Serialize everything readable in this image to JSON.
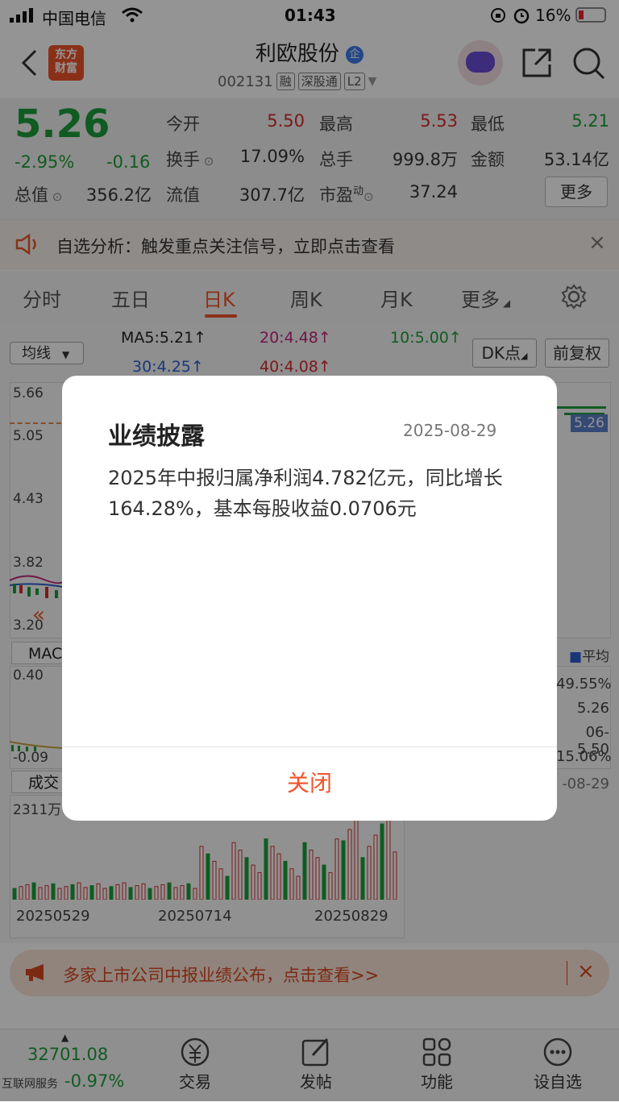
{
  "status_bar": {
    "carrier": "中国电信",
    "time": "01:43",
    "battery": "16%"
  },
  "header": {
    "brand_line1": "东方",
    "brand_line2": "财富",
    "title": "利欧股份",
    "title_badge": "企",
    "code": "002131",
    "tags": [
      "融",
      "深股通",
      "L2"
    ]
  },
  "quote": {
    "price": "5.26",
    "change_pct": "-2.95%",
    "change": "-0.16",
    "open_label": "今开",
    "open": "5.50",
    "high_label": "最高",
    "high": "5.53",
    "low_label": "最低",
    "low": "5.21",
    "turnover_label": "换手",
    "turnover": "17.09%",
    "volume_label": "总手",
    "volume": "999.8万",
    "amount_label": "金额",
    "amount": "53.14亿",
    "mktcap_label": "总值",
    "mktcap": "356.2亿",
    "float_label": "流值",
    "float": "307.7亿",
    "pe_label": "市盈",
    "pe_sup": "动",
    "pe": "37.24",
    "more": "更多"
  },
  "notice": {
    "text": "自选分析：触发重点关注信号，立即点击查看"
  },
  "tabs": [
    "分时",
    "五日",
    "日K",
    "周K",
    "月K",
    "更多"
  ],
  "chart": {
    "ma_selector": "均线",
    "ma5": "MA5:5.21↑",
    "ma20": "20:4.48↑",
    "ma10": "10:5.00↑",
    "ma30": "30:4.25↑",
    "ma40": "40:4.08↑",
    "dk_button": "DK点",
    "adjust_button": "前复权",
    "price_ticks": [
      "5.66",
      "5.05",
      "4.43",
      "3.82",
      "3.20"
    ],
    "last_price_tag": "5.26",
    "macd_label": "MAC",
    "macd_ticks": [
      "0.40",
      "-0.09"
    ],
    "vol_label": "成交",
    "vol_tick": "2311万",
    "dates": [
      "20250529",
      "20250714",
      "20250829"
    ],
    "right_panel": {
      "legend": "平均",
      "v1": "49.55%",
      "v2": "5.26",
      "v3": "06-5.50",
      "v4": "15.06%",
      "v5": "-08-29"
    }
  },
  "banner": {
    "text": "多家上市公司中报业绩公布，点击查看>>"
  },
  "bottom_nav": {
    "index_value": "32701.08",
    "index_label": "互联网服务",
    "index_change": "-0.97%",
    "items": [
      "交易",
      "发帖",
      "功能",
      "设自选"
    ]
  },
  "dialog": {
    "title": "业绩披露",
    "date": "2025-08-29",
    "body": "2025年中报归属净利润4.782亿元，同比增长164.28%，基本每股收益0.0706元",
    "close": "关闭"
  },
  "colors": {
    "accent": "#f0542a",
    "up": "#d62b2b",
    "down": "#1c9e3a"
  }
}
